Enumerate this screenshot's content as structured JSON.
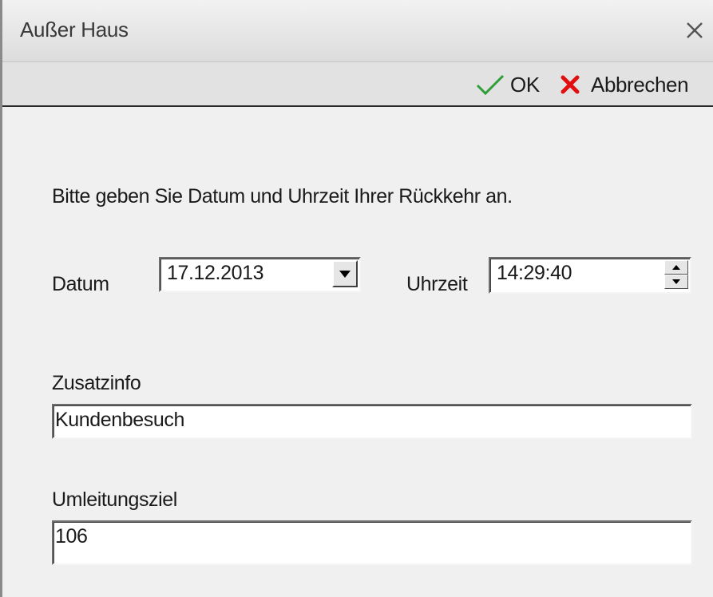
{
  "window": {
    "title": "Außer Haus"
  },
  "toolbar": {
    "ok_label": "OK",
    "cancel_label": "Abbrechen"
  },
  "form": {
    "instruction": "Bitte geben Sie Datum und Uhrzeit Ihrer Rückkehr an.",
    "date_label": "Datum",
    "date_value": "17.12.2013",
    "time_label": "Uhrzeit",
    "time_value": "14:29:40",
    "extra_info_label": "Zusatzinfo",
    "extra_info_value": "Kundenbesuch",
    "redirect_label": "Umleitungsziel",
    "redirect_value": "106"
  },
  "icons": {
    "close": "close-icon",
    "ok": "checkmark-icon",
    "cancel": "x-icon",
    "dropdown": "chevron-down-icon",
    "spin_up": "arrow-up-icon",
    "spin_down": "arrow-down-icon"
  },
  "colors": {
    "ok_check": "#2e9e3a",
    "cancel_x": "#e01010",
    "background": "#f0f0f0"
  }
}
